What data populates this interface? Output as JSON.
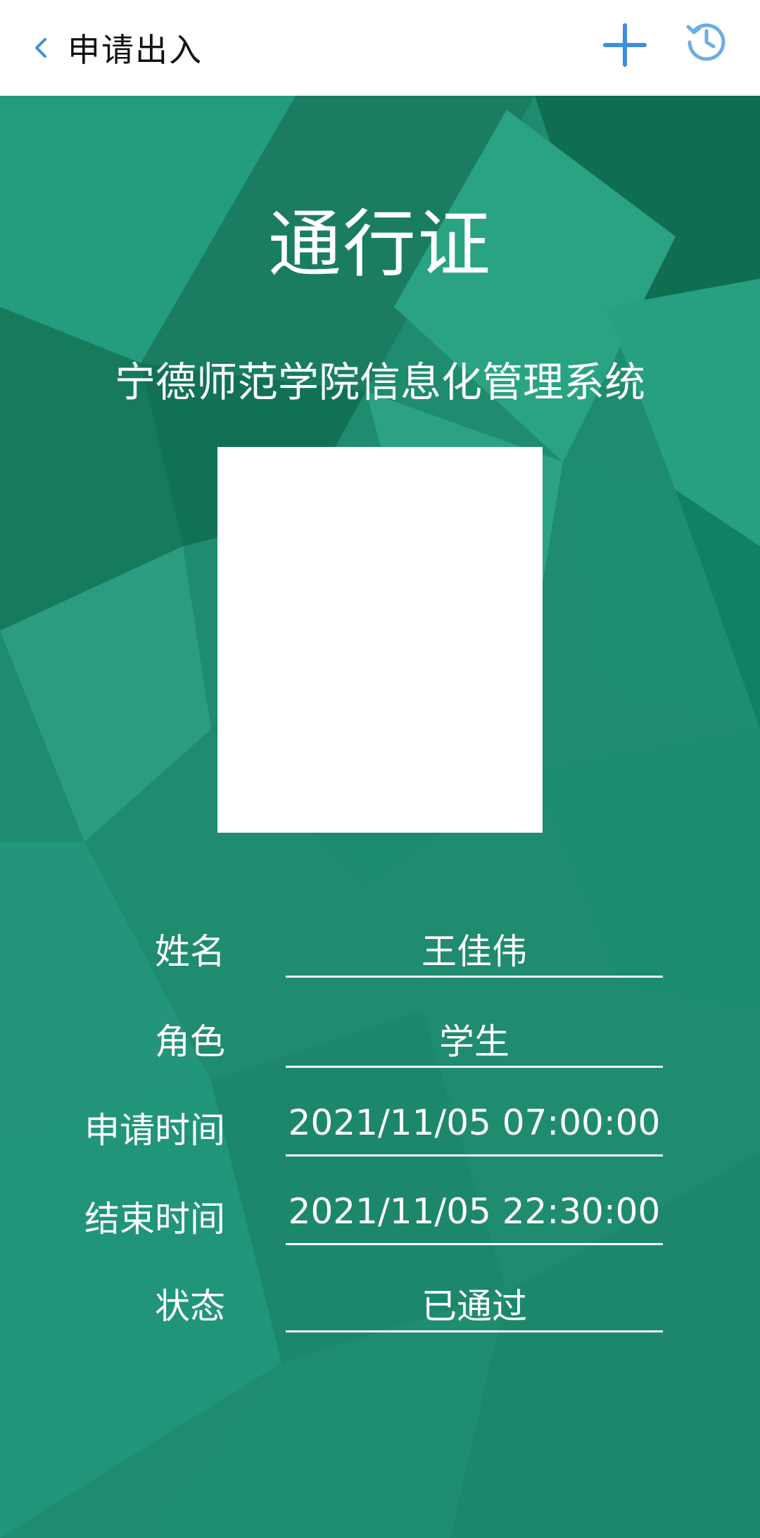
{
  "header": {
    "title": "申请出入",
    "back_icon": "chevron-left-icon",
    "add_icon": "plus-icon",
    "history_icon": "history-icon",
    "accent_color": "#3d8fe0"
  },
  "pass": {
    "title": "通行证",
    "system_name": "宁德师范学院信息化管理系统",
    "background_color": "#1e8a70",
    "fields": [
      {
        "label": "姓名",
        "value": "王佳伟"
      },
      {
        "label": "角色",
        "value": "学生"
      },
      {
        "label": "申请时间",
        "value": "2021/11/05 07:00:00"
      },
      {
        "label": "结束时间",
        "value": "2021/11/05 22:30:00"
      },
      {
        "label": "状态",
        "value": "已通过"
      }
    ]
  }
}
